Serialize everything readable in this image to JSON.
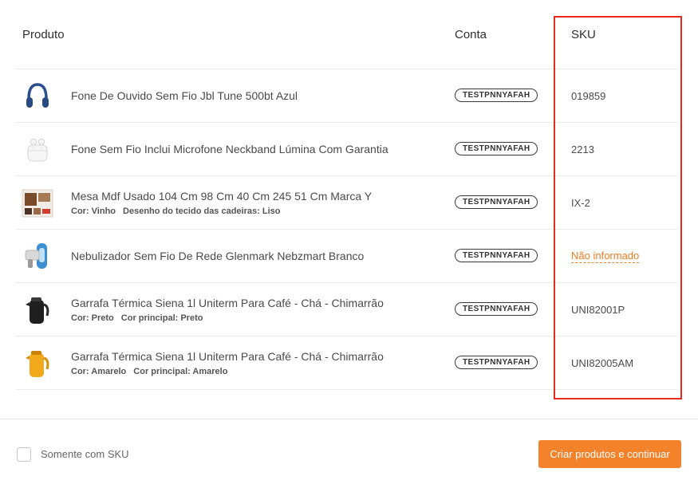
{
  "table": {
    "headers": {
      "produto": "Produto",
      "conta": "Conta",
      "sku": "SKU"
    },
    "rows": [
      {
        "title": "Fone De Ouvido Sem Fio Jbl Tune 500bt Azul",
        "attrs": [],
        "account": "TESTPNNYAFAH",
        "sku": "019859",
        "sku_missing": false,
        "icon": "headphones-icon"
      },
      {
        "title": "Fone Sem Fio Inclui Microfone Neckband Lúmina Com Garantia",
        "attrs": [],
        "account": "TESTPNNYAFAH",
        "sku": "2213",
        "sku_missing": false,
        "icon": "earbuds-icon"
      },
      {
        "title": "Mesa Mdf Usado 104 Cm 98 Cm 40 Cm 245 51 Cm Marca Y",
        "attrs": [
          "Cor: Vinho",
          "Desenho do tecido das cadeiras: Liso"
        ],
        "account": "TESTPNNYAFAH",
        "sku": "IX-2",
        "sku_missing": false,
        "icon": "table-furniture-icon"
      },
      {
        "title": "Nebulizador Sem Fio De Rede Glenmark Nebzmart Branco",
        "attrs": [],
        "account": "TESTPNNYAFAH",
        "sku": "Não informado",
        "sku_missing": true,
        "icon": "nebulizer-icon"
      },
      {
        "title": "Garrafa Térmica Siena 1l Uniterm Para Café - Chá - Chimarrão",
        "attrs": [
          "Cor: Preto",
          "Cor principal: Preto"
        ],
        "account": "TESTPNNYAFAH",
        "sku": "UNI82001P",
        "sku_missing": false,
        "icon": "thermos-black-icon"
      },
      {
        "title": "Garrafa Térmica Siena 1l Uniterm Para Café - Chá - Chimarrão",
        "attrs": [
          "Cor: Amarelo",
          "Cor principal: Amarelo"
        ],
        "account": "TESTPNNYAFAH",
        "sku": "UNI82005AM",
        "sku_missing": false,
        "icon": "thermos-yellow-icon"
      }
    ]
  },
  "footer": {
    "checkbox_label": "Somente com SKU",
    "checkbox_checked": false,
    "cta_label": "Criar produtos e continuar"
  },
  "colors": {
    "accent": "#f4822a",
    "missing_sku": "#f07c20",
    "highlight": "#e8291c"
  }
}
